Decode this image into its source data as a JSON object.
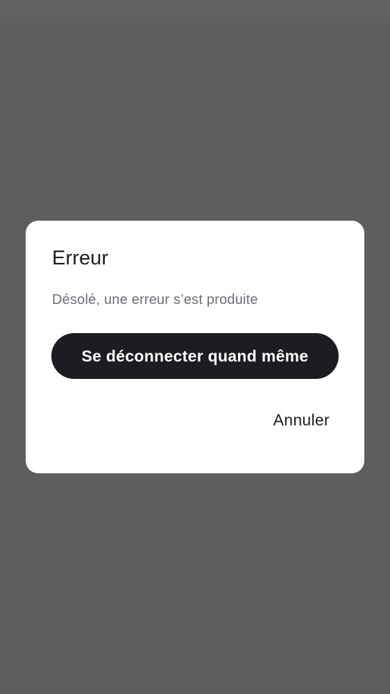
{
  "dialog": {
    "title": "Erreur",
    "message": "Désolé, une erreur s’est produite",
    "primary_button_label": "Se déconnecter quand même",
    "cancel_button_label": "Annuler"
  },
  "colors": {
    "scrim": "#5e5e5e",
    "dialog_background": "#ffffff",
    "primary_button_background": "#1c1d21",
    "primary_button_text": "#ffffff",
    "title_text": "#1c1d21",
    "message_text": "#6b6f78"
  }
}
